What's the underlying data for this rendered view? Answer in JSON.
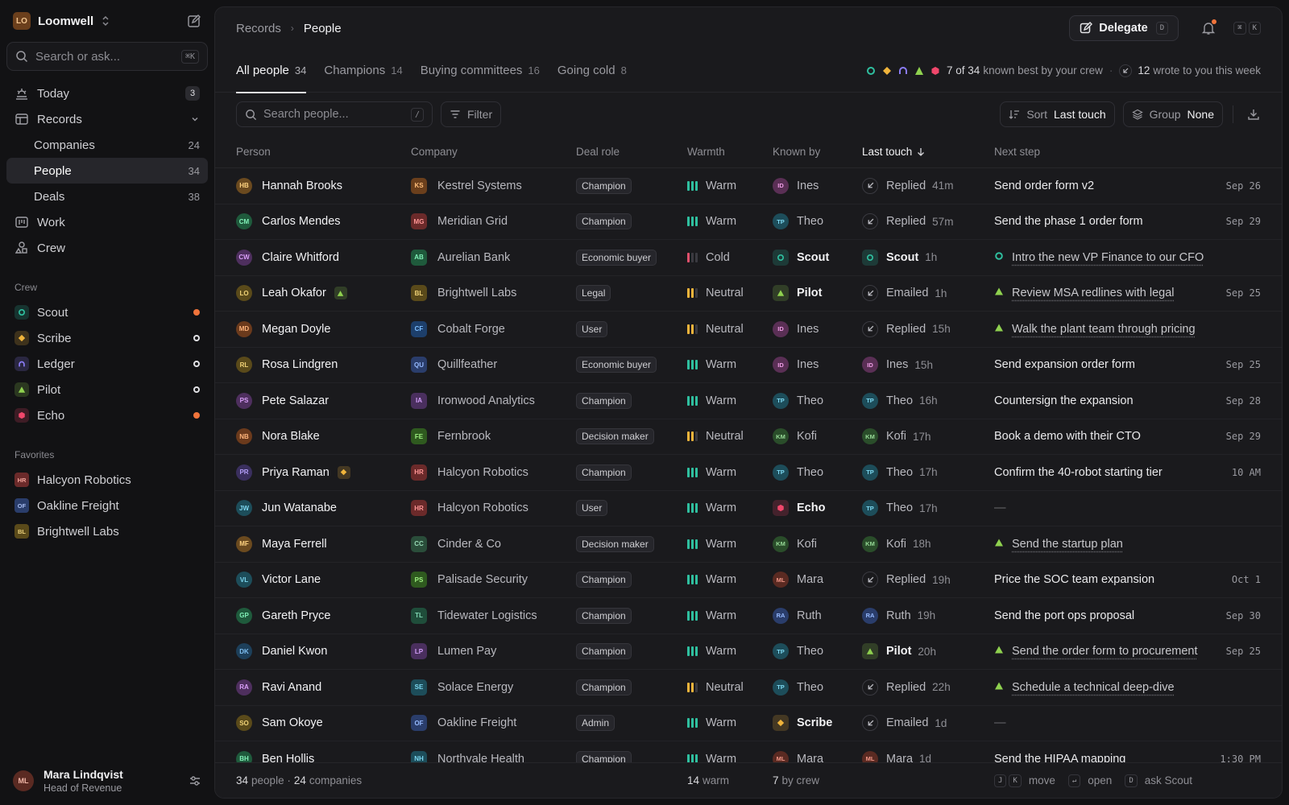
{
  "workspace": {
    "initials": "LO",
    "name": "Loomwell"
  },
  "search": {
    "placeholder": "Search or ask...",
    "shortcut": "⌘K"
  },
  "nav": {
    "today": {
      "label": "Today",
      "count": "3"
    },
    "records": {
      "label": "Records"
    },
    "companies": {
      "label": "Companies",
      "count": "24"
    },
    "people": {
      "label": "People",
      "count": "34"
    },
    "deals": {
      "label": "Deals",
      "count": "38"
    },
    "work": {
      "label": "Work"
    },
    "crew": {
      "label": "Crew"
    }
  },
  "crew_section": {
    "title": "Crew",
    "items": [
      {
        "name": "Scout",
        "color": "#2fbf9f",
        "status": "active"
      },
      {
        "name": "Scribe",
        "color": "#f0b43b",
        "status": "idle"
      },
      {
        "name": "Ledger",
        "color": "#8b7cf6",
        "status": "idle"
      },
      {
        "name": "Pilot",
        "color": "#8fd14f",
        "status": "idle"
      },
      {
        "name": "Echo",
        "color": "#f0476b",
        "status": "active"
      }
    ]
  },
  "favorites": {
    "title": "Favorites",
    "items": [
      {
        "initials": "HR",
        "name": "Halcyon Robotics"
      },
      {
        "initials": "OF",
        "name": "Oakline Freight"
      },
      {
        "initials": "BL",
        "name": "Brightwell Labs"
      }
    ]
  },
  "user": {
    "initials": "ML",
    "name": "Mara Lindqvist",
    "role": "Head of Revenue"
  },
  "breadcrumb": {
    "parent": "Records",
    "current": "People"
  },
  "delegate": {
    "label": "Delegate",
    "shortcut": "D"
  },
  "cmdk": {
    "k1": "⌘",
    "k2": "K"
  },
  "tabs": [
    {
      "label": "All people",
      "count": "34"
    },
    {
      "label": "Champions",
      "count": "14"
    },
    {
      "label": "Buying committees",
      "count": "16"
    },
    {
      "label": "Going cold",
      "count": "8"
    }
  ],
  "crew_summary": {
    "known_count": "7 of 34",
    "known_text": "known best by your crew",
    "sep": "·",
    "wrote_count": "12",
    "wrote_text": "wrote to you this week"
  },
  "toolbar": {
    "search_placeholder": "Search people...",
    "search_shortcut": "/",
    "filter_label": "Filter",
    "sort_label": "Sort",
    "sort_value": "Last touch",
    "group_label": "Group",
    "group_value": "None"
  },
  "columns": {
    "person": "Person",
    "company": "Company",
    "role": "Deal role",
    "warmth": "Warmth",
    "known": "Known by",
    "last": "Last touch",
    "next": "Next step"
  },
  "rows": [
    {
      "initials": "HB",
      "name": "Hannah Brooks",
      "av": "#6b4a1f",
      "co_i": "KS",
      "company": "Kestrel Systems",
      "co_c": "#6b3f1c",
      "role": "Champion",
      "warmth": "Warm",
      "w": 3,
      "known": "Ines",
      "known_i": "ID",
      "known_c": "#5a2f55",
      "known_type": "human",
      "last_type": "reply",
      "last": "Replied",
      "last_time": "41m",
      "next": "Send order form v2",
      "next_type": "plain",
      "date": "Sep 26"
    },
    {
      "initials": "CM",
      "name": "Carlos Mendes",
      "av": "#1f5a3c",
      "co_i": "MG",
      "company": "Meridian Grid",
      "co_c": "#6b2a2a",
      "role": "Champion",
      "warmth": "Warm",
      "w": 3,
      "known": "Theo",
      "known_i": "TP",
      "known_c": "#1d4d5a",
      "known_type": "human",
      "last_type": "reply",
      "last": "Replied",
      "last_time": "57m",
      "next": "Send the phase 1 order form",
      "next_type": "plain",
      "date": "Sep 29"
    },
    {
      "initials": "CW",
      "name": "Claire Whitford",
      "av": "#4e2f5e",
      "co_i": "AB",
      "company": "Aurelian Bank",
      "co_c": "#1f5a3c",
      "role": "Economic buyer",
      "warmth": "Cold",
      "w": 1,
      "known": "Scout",
      "known_type": "agent",
      "agent_c": "#2fbf9f",
      "last_type": "agent",
      "last": "Scout",
      "last_c": "#2fbf9f",
      "last_time": "1h",
      "next": "Intro the new VP Finance to our CFO",
      "next_type": "task",
      "next_icon": "#2fbf9f",
      "date": ""
    },
    {
      "initials": "LO",
      "name": "Leah Okafor",
      "av": "#5a4a1a",
      "badge": "#8fd14f",
      "co_i": "BL",
      "company": "Brightwell Labs",
      "co_c": "#5a4a1a",
      "role": "Legal",
      "warmth": "Neutral",
      "w": 2,
      "known": "Pilot",
      "known_type": "agent",
      "agent_c": "#8fd14f",
      "last_type": "reply",
      "last": "Emailed",
      "last_time": "1h",
      "next": "Review MSA redlines with legal",
      "next_type": "task",
      "next_icon": "#8fd14f",
      "date": "Sep 25"
    },
    {
      "initials": "MD",
      "name": "Megan Doyle",
      "av": "#6b3a1c",
      "co_i": "CF",
      "company": "Cobalt Forge",
      "co_c": "#1d3f6b",
      "role": "User",
      "warmth": "Neutral",
      "w": 2,
      "known": "Ines",
      "known_i": "ID",
      "known_c": "#5a2f55",
      "known_type": "human",
      "last_type": "reply",
      "last": "Replied",
      "last_time": "15h",
      "next": "Walk the plant team through pricing",
      "next_type": "task",
      "next_icon": "#8fd14f",
      "date": ""
    },
    {
      "initials": "RL",
      "name": "Rosa Lindgren",
      "av": "#5a4a1a",
      "co_i": "QU",
      "company": "Quillfeather",
      "co_c": "#2a3d6b",
      "role": "Economic buyer",
      "warmth": "Warm",
      "w": 3,
      "known": "Ines",
      "known_i": "ID",
      "known_c": "#5a2f55",
      "known_type": "human",
      "last_type": "human",
      "last": "Ines",
      "last_i": "ID",
      "last_c": "#5a2f55",
      "last_time": "15h",
      "next": "Send expansion order form",
      "next_type": "plain",
      "date": "Sep 25"
    },
    {
      "initials": "PS",
      "name": "Pete Salazar",
      "av": "#4e2f5e",
      "co_i": "IA",
      "company": "Ironwood Analytics",
      "co_c": "#4a2f5e",
      "role": "Champion",
      "warmth": "Warm",
      "w": 3,
      "known": "Theo",
      "known_i": "TP",
      "known_c": "#1d4d5a",
      "known_type": "human",
      "last_type": "human",
      "last": "Theo",
      "last_i": "TP",
      "last_c": "#1d4d5a",
      "last_time": "16h",
      "next": "Countersign the expansion",
      "next_type": "plain",
      "date": "Sep 28"
    },
    {
      "initials": "NB",
      "name": "Nora Blake",
      "av": "#6b3a1c",
      "co_i": "FE",
      "company": "Fernbrook",
      "co_c": "#2f5a1f",
      "role": "Decision maker",
      "warmth": "Neutral",
      "w": 2,
      "known": "Kofi",
      "known_i": "KM",
      "known_c": "#2a4d2a",
      "known_type": "human",
      "last_type": "human",
      "last": "Kofi",
      "last_i": "KM",
      "last_c": "#2a4d2a",
      "last_time": "17h",
      "next": "Book a demo with their CTO",
      "next_type": "plain",
      "date": "Sep 29"
    },
    {
      "initials": "PR",
      "name": "Priya Raman",
      "av": "#3a2f5e",
      "badge": "#f0b43b",
      "co_i": "HR",
      "company": "Halcyon Robotics",
      "co_c": "#6b2a2a",
      "role": "Champion",
      "warmth": "Warm",
      "w": 3,
      "known": "Theo",
      "known_i": "TP",
      "known_c": "#1d4d5a",
      "known_type": "human",
      "last_type": "human",
      "last": "Theo",
      "last_i": "TP",
      "last_c": "#1d4d5a",
      "last_time": "17h",
      "next": "Confirm the 40-robot starting tier",
      "next_type": "plain",
      "date": "10 AM"
    },
    {
      "initials": "JW",
      "name": "Jun Watanabe",
      "av": "#1d4d5a",
      "co_i": "HR",
      "company": "Halcyon Robotics",
      "co_c": "#6b2a2a",
      "role": "User",
      "warmth": "Warm",
      "w": 3,
      "known": "Echo",
      "known_type": "agent",
      "agent_c": "#f0476b",
      "last_type": "human",
      "last": "Theo",
      "last_i": "TP",
      "last_c": "#1d4d5a",
      "last_time": "17h",
      "next": "—",
      "next_type": "none",
      "date": ""
    },
    {
      "initials": "MF",
      "name": "Maya Ferrell",
      "av": "#6b4a1f",
      "co_i": "CC",
      "company": "Cinder & Co",
      "co_c": "#2a4d3a",
      "role": "Decision maker",
      "warmth": "Warm",
      "w": 3,
      "known": "Kofi",
      "known_i": "KM",
      "known_c": "#2a4d2a",
      "known_type": "human",
      "last_type": "human",
      "last": "Kofi",
      "last_i": "KM",
      "last_c": "#2a4d2a",
      "last_time": "18h",
      "next": "Send the startup plan",
      "next_type": "task",
      "next_icon": "#8fd14f",
      "date": ""
    },
    {
      "initials": "VL",
      "name": "Victor Lane",
      "av": "#1d4d5a",
      "co_i": "PS",
      "company": "Palisade Security",
      "co_c": "#2f5a1f",
      "role": "Champion",
      "warmth": "Warm",
      "w": 3,
      "known": "Mara",
      "known_i": "ML",
      "known_c": "#5a2a22",
      "known_type": "human",
      "last_type": "reply",
      "last": "Replied",
      "last_time": "19h",
      "next": "Price the SOC team expansion",
      "next_type": "plain",
      "date": "Oct 1"
    },
    {
      "initials": "GP",
      "name": "Gareth Pryce",
      "av": "#1f5a3c",
      "co_i": "TL",
      "company": "Tidewater Logistics",
      "co_c": "#1f4d3a",
      "role": "Champion",
      "warmth": "Warm",
      "w": 3,
      "known": "Ruth",
      "known_i": "RA",
      "known_c": "#2a3d6b",
      "known_type": "human",
      "last_type": "human",
      "last": "Ruth",
      "last_i": "RA",
      "last_c": "#2a3d6b",
      "last_time": "19h",
      "next": "Send the port ops proposal",
      "next_type": "plain",
      "date": "Sep 30"
    },
    {
      "initials": "DK",
      "name": "Daniel Kwon",
      "av": "#1d3f5a",
      "co_i": "LP",
      "company": "Lumen Pay",
      "co_c": "#4a2f5e",
      "role": "Champion",
      "warmth": "Warm",
      "w": 3,
      "known": "Theo",
      "known_i": "TP",
      "known_c": "#1d4d5a",
      "known_type": "human",
      "last_type": "agent",
      "last": "Pilot",
      "last_c": "#8fd14f",
      "last_time": "20h",
      "next": "Send the order form to procurement",
      "next_type": "task",
      "next_icon": "#8fd14f",
      "date": "Sep 25"
    },
    {
      "initials": "RA",
      "name": "Ravi Anand",
      "av": "#4e2f5e",
      "co_i": "SE",
      "company": "Solace Energy",
      "co_c": "#1d4d5a",
      "role": "Champion",
      "warmth": "Neutral",
      "w": 2,
      "known": "Theo",
      "known_i": "TP",
      "known_c": "#1d4d5a",
      "known_type": "human",
      "last_type": "reply",
      "last": "Replied",
      "last_time": "22h",
      "next": "Schedule a technical deep-dive",
      "next_type": "task",
      "next_icon": "#8fd14f",
      "date": ""
    },
    {
      "initials": "SO",
      "name": "Sam Okoye",
      "av": "#5a4a1a",
      "co_i": "OF",
      "company": "Oakline Freight",
      "co_c": "#2a3d6b",
      "role": "Admin",
      "warmth": "Warm",
      "w": 3,
      "known": "Scribe",
      "known_type": "agent",
      "agent_c": "#f0b43b",
      "last_type": "reply",
      "last": "Emailed",
      "last_time": "1d",
      "next": "—",
      "next_type": "none",
      "date": ""
    },
    {
      "initials": "BH",
      "name": "Ben Hollis",
      "av": "#1f5a3c",
      "co_i": "NH",
      "company": "Northvale Health",
      "co_c": "#1d4d5a",
      "role": "Champion",
      "warmth": "Warm",
      "w": 3,
      "known": "Mara",
      "known_i": "ML",
      "known_c": "#5a2a22",
      "known_type": "human",
      "last_type": "human",
      "last": "Mara",
      "last_i": "ML",
      "last_c": "#5a2a22",
      "last_time": "1d",
      "next": "Send the HIPAA mapping",
      "next_type": "plain",
      "date": "1:30 PM"
    }
  ],
  "footer": {
    "people_count": "34",
    "people_label": "people ·",
    "companies_count": "24",
    "companies_label": "companies",
    "warm_count": "14",
    "warm_label": "warm",
    "crew_count": "7",
    "crew_label": "by crew",
    "k_j": "J",
    "k_k": "K",
    "move": "move",
    "k_enter": "↵",
    "open": "open",
    "k_d": "D",
    "ask": "ask Scout"
  },
  "colors": {
    "warm": "#2fbf9f",
    "neutral": "#f0b43b",
    "cold": "#e0506b",
    "bar_off": "#3a3a40",
    "accent_dot": "#f0743b"
  }
}
